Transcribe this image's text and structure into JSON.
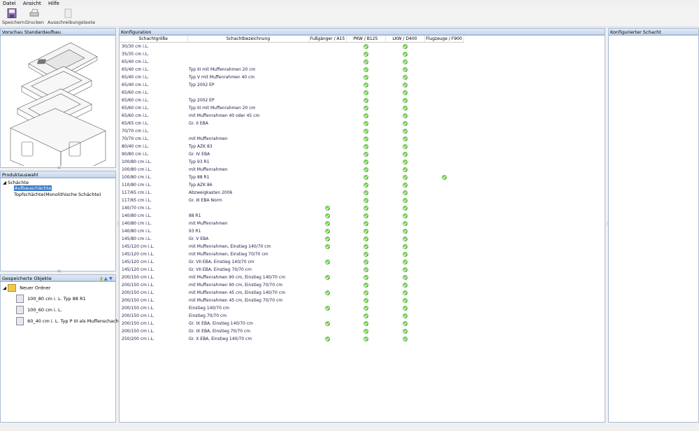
{
  "menu": [
    "Datei",
    "Ansicht",
    "Hilfe"
  ],
  "toolbar": {
    "save_label": "Speichern",
    "print_label": "Drucken",
    "tender_label": "Ausschreibungstexte"
  },
  "preview": {
    "title": "Vorschau Standardaufbau"
  },
  "product": {
    "title": "Produktauswahl",
    "root": "Schächte",
    "items": [
      "Aufbauschächte",
      "Topfschächte(Monolithische Schächte)"
    ]
  },
  "saved": {
    "title": "Gespeicherte Objekte",
    "folder": "Neuer Ordner",
    "items": [
      "100_80 cm i. L. Typ 88 R1",
      "100_60 cm i. L.",
      "60_40 cm i. L. Typ P III als Muffenschacht"
    ]
  },
  "config": {
    "title": "Konfiguration",
    "columns": [
      "Schachtgröße",
      "Schachtbezeichnung",
      "Fußgänger / A15",
      "PKW / B125",
      "LKW / D400",
      "Flugzeuge / F900"
    ],
    "rows": [
      {
        "size": "30/30 cm i.L.",
        "name": "",
        "a15": false,
        "b125": true,
        "d400": true,
        "f900": false
      },
      {
        "size": "35/35 cm i.L.",
        "name": "",
        "a15": false,
        "b125": true,
        "d400": true,
        "f900": false
      },
      {
        "size": "65/40 cm i.L.",
        "name": "",
        "a15": false,
        "b125": true,
        "d400": true,
        "f900": false
      },
      {
        "size": "65/40 cm i.L.",
        "name": "Typ III mit Muffenrahmen 20 cm",
        "a15": false,
        "b125": true,
        "d400": true,
        "f900": false
      },
      {
        "size": "65/40 cm i.L.",
        "name": "Typ V mit Muffenrahmen 40 cm",
        "a15": false,
        "b125": true,
        "d400": true,
        "f900": false
      },
      {
        "size": "65/40 cm i.L.",
        "name": "Typ 2002 EP",
        "a15": false,
        "b125": true,
        "d400": true,
        "f900": false
      },
      {
        "size": "65/60 cm i.L.",
        "name": "",
        "a15": false,
        "b125": true,
        "d400": true,
        "f900": false
      },
      {
        "size": "65/60 cm i.L.",
        "name": "Typ 2002 EP",
        "a15": false,
        "b125": true,
        "d400": true,
        "f900": false
      },
      {
        "size": "65/60 cm i.L.",
        "name": "Typ III mit Muffenrahmen 20 cm",
        "a15": false,
        "b125": true,
        "d400": true,
        "f900": false
      },
      {
        "size": "65/60 cm i.L.",
        "name": "mit Muffenrahmen 40 oder 45 cm",
        "a15": false,
        "b125": true,
        "d400": true,
        "f900": false
      },
      {
        "size": "65/65 cm i.L.",
        "name": "Gr. II EBA",
        "a15": false,
        "b125": true,
        "d400": true,
        "f900": false
      },
      {
        "size": "70/70 cm i.L.",
        "name": "",
        "a15": false,
        "b125": true,
        "d400": true,
        "f900": false
      },
      {
        "size": "70/70 cm i.L.",
        "name": "mit Muffenrahmen",
        "a15": false,
        "b125": true,
        "d400": true,
        "f900": false
      },
      {
        "size": "80/40 cm i.L.",
        "name": "Typ AZK 83",
        "a15": false,
        "b125": true,
        "d400": true,
        "f900": false
      },
      {
        "size": "90/80 cm i.L.",
        "name": "Gr. IV EBA",
        "a15": false,
        "b125": true,
        "d400": true,
        "f900": false
      },
      {
        "size": "100/80 cm i.L.",
        "name": "Typ 93 R1",
        "a15": false,
        "b125": true,
        "d400": true,
        "f900": false
      },
      {
        "size": "100/80 cm i.L.",
        "name": "mit Muffenrahmen",
        "a15": false,
        "b125": true,
        "d400": true,
        "f900": false
      },
      {
        "size": "100/80 cm i.L.",
        "name": "Typ 88 R1",
        "a15": false,
        "b125": true,
        "d400": true,
        "f900": true
      },
      {
        "size": "110/80 cm i.L.",
        "name": "Typ AZK 86",
        "a15": false,
        "b125": true,
        "d400": true,
        "f900": false
      },
      {
        "size": "117/65 cm i.L.",
        "name": "Abzweigkasten 2006",
        "a15": false,
        "b125": true,
        "d400": true,
        "f900": false
      },
      {
        "size": "117/65 cm i.L.",
        "name": "Gr. III EBA Norm",
        "a15": false,
        "b125": true,
        "d400": true,
        "f900": false
      },
      {
        "size": "140/70 cm i.L.",
        "name": "",
        "a15": true,
        "b125": true,
        "d400": true,
        "f900": false
      },
      {
        "size": "140/80 cm i.L.",
        "name": "88 R1",
        "a15": true,
        "b125": true,
        "d400": true,
        "f900": false
      },
      {
        "size": "140/80 cm i.L.",
        "name": "mit Muffenrahmen",
        "a15": true,
        "b125": true,
        "d400": true,
        "f900": false
      },
      {
        "size": "140/80 cm i.L.",
        "name": "93 R1",
        "a15": true,
        "b125": true,
        "d400": true,
        "f900": false
      },
      {
        "size": "145/80 cm i.L.",
        "name": "Gr. V EBA",
        "a15": true,
        "b125": true,
        "d400": true,
        "f900": false
      },
      {
        "size": "145/120 cm i.L.",
        "name": "mit Muffenrahmen, Einstieg 140/70 cm",
        "a15": true,
        "b125": true,
        "d400": true,
        "f900": false
      },
      {
        "size": "145/120 cm i.L.",
        "name": "mit Muffenrahmen, Einstieg 70/70 cm",
        "a15": false,
        "b125": true,
        "d400": true,
        "f900": false
      },
      {
        "size": "145/120 cm i.L.",
        "name": "Gr. VII EBA, Einstieg 140/70 cm",
        "a15": true,
        "b125": true,
        "d400": true,
        "f900": false
      },
      {
        "size": "145/120 cm i.L.",
        "name": "Gr. VII EBA, Einstieg 70/70 cm",
        "a15": false,
        "b125": true,
        "d400": true,
        "f900": false
      },
      {
        "size": "200/150 cm i.L.",
        "name": "mit Muffenrahmen 90 cm, Einstieg 140/70 cm",
        "a15": true,
        "b125": true,
        "d400": true,
        "f900": false
      },
      {
        "size": "200/150 cm i.L.",
        "name": "mit Muffenrahmen 90 cm, Einstieg 70/70 cm",
        "a15": false,
        "b125": true,
        "d400": true,
        "f900": false
      },
      {
        "size": "200/150 cm i.L.",
        "name": "mit Muffenrahmen 45 cm, Einstieg 140/70 cm",
        "a15": true,
        "b125": true,
        "d400": true,
        "f900": false
      },
      {
        "size": "200/150 cm i.L.",
        "name": "mit Muffenrahmen 45 cm, Einstieg 70/70 cm",
        "a15": false,
        "b125": true,
        "d400": true,
        "f900": false
      },
      {
        "size": "200/150 cm i.L.",
        "name": "Einstieg 140/70 cm",
        "a15": true,
        "b125": true,
        "d400": true,
        "f900": false
      },
      {
        "size": "200/150 cm i.L.",
        "name": "Einstieg 70/70 cm",
        "a15": false,
        "b125": true,
        "d400": true,
        "f900": false
      },
      {
        "size": "200/150 cm i.L.",
        "name": "Gr. IX EBA, Einstieg 140/70 cm",
        "a15": true,
        "b125": true,
        "d400": true,
        "f900": false
      },
      {
        "size": "200/150 cm i.L.",
        "name": "Gr. IX EBA, Einstieg 70/70 cm",
        "a15": false,
        "b125": true,
        "d400": true,
        "f900": false
      },
      {
        "size": "250/200 cm i.L.",
        "name": "Gr. X EBA, Einstieg 140/70 cm",
        "a15": true,
        "b125": true,
        "d400": true,
        "f900": false
      }
    ]
  },
  "configured": {
    "title": "Konfigurierter Schacht"
  },
  "colors": {
    "check": "#2e9a12",
    "selection": "#3b79c9",
    "panel_border": "#a9bcd6"
  }
}
